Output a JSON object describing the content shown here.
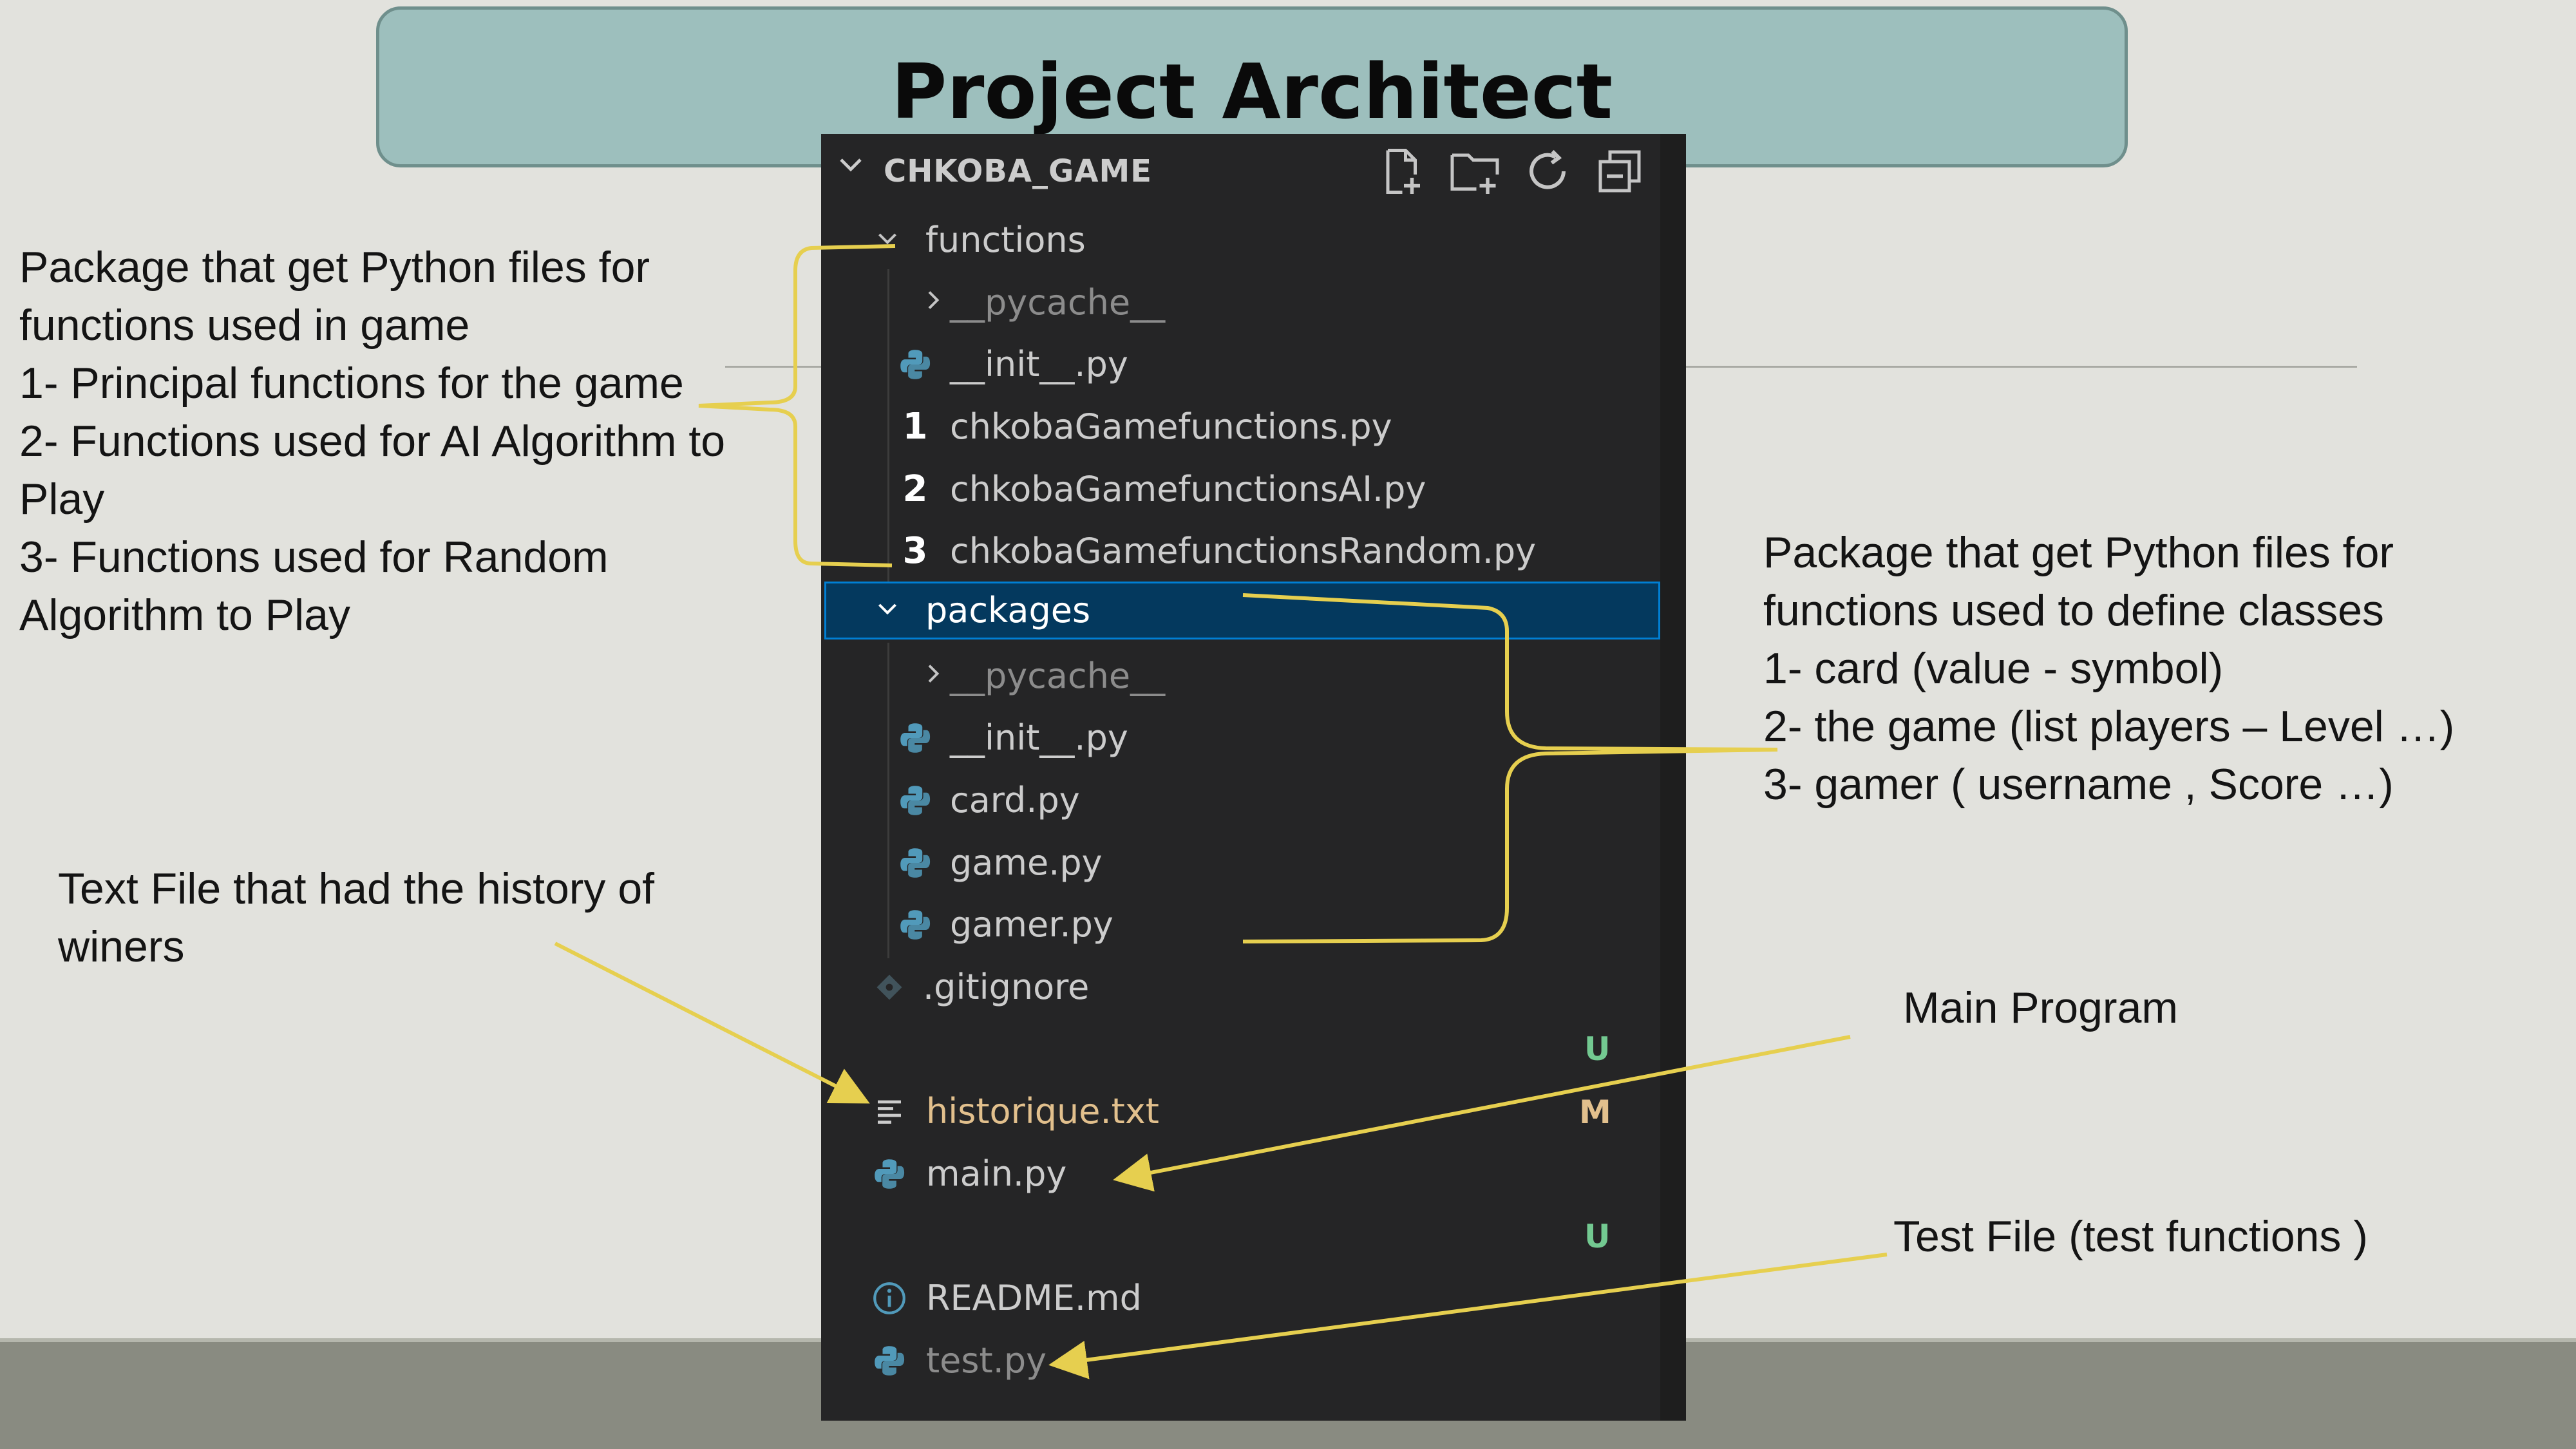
{
  "slide": {
    "title": "Project Architect"
  },
  "explorer": {
    "root_label": "CHKOBA_GAME",
    "toolbar": {
      "new_file_icon": "new-file-icon",
      "new_folder_icon": "new-folder-icon",
      "refresh_icon": "refresh-icon",
      "collapse_icon": "collapse-all-icon"
    },
    "functions_folder": {
      "label": "functions",
      "pycache": "__pycache__",
      "init": "__init__.py",
      "file1": "chkobaGamefunctions.py",
      "file2": "chkobaGamefunctionsAI.py",
      "file3": "chkobaGamefunctionsRandom.py",
      "num1": "1",
      "num2": "2",
      "num3": "3"
    },
    "packages_folder": {
      "label": "packages",
      "pycache": "__pycache__",
      "init": "__init__.py",
      "card": "card.py",
      "game": "game.py",
      "gamer": "gamer.py"
    },
    "gitignore": ".gitignore",
    "historique": "historique.txt",
    "main": "main.py",
    "readme": "README.md",
    "test": "test.py",
    "badges": {
      "u1": "U",
      "m": "M",
      "u2": "U"
    }
  },
  "annotations": {
    "functions_note": [
      "Package that get Python files for",
      "functions used in game",
      "1- Principal functions for the game",
      "2- Functions used for AI Algorithm to",
      "Play",
      "3- Functions used for Random",
      "Algorithm to Play"
    ],
    "packages_note": [
      "Package that get Python files for",
      "functions used to define classes",
      "1- card (value - symbol)",
      "2- the game (list players – Level …)",
      "3- gamer ( username , Score …)"
    ],
    "history_note": [
      "Text File that had the history of",
      "winers"
    ],
    "main_note": "Main Program",
    "test_note": "Test File (test functions )"
  },
  "colors": {
    "annotation_line": "#e6cf4f",
    "selection": "#04395e",
    "badge_untracked": "#73c991",
    "badge_modified": "#e2c08d",
    "python_icon": "#519aba"
  }
}
